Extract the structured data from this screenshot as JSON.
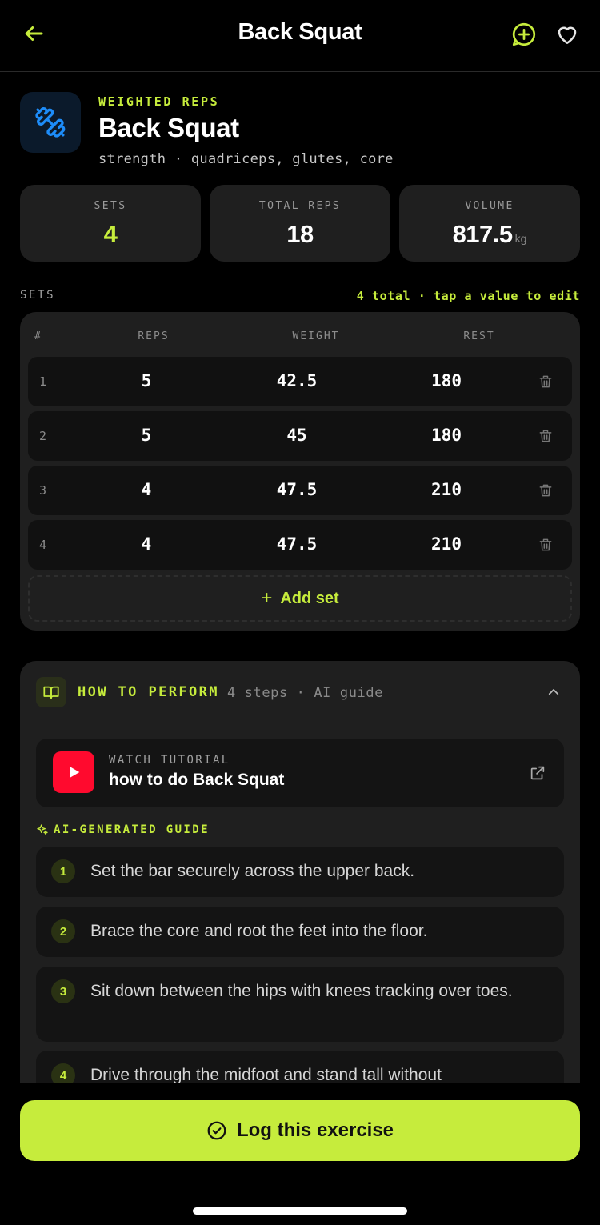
{
  "header": {
    "title": "Back Squat",
    "back_icon": "arrow-left-icon",
    "add_icon": "plus-circle-icon",
    "favorite_icon": "heart-icon"
  },
  "exercise": {
    "type": "WEIGHTED REPS",
    "name": "Back Squat",
    "tags": "strength · quadriceps, glutes, core",
    "icon": "dumbbell-icon"
  },
  "stats": [
    {
      "label": "SETS",
      "value": "4",
      "unit": ""
    },
    {
      "label": "TOTAL REPS",
      "value": "18",
      "unit": ""
    },
    {
      "label": "VOLUME",
      "value": "817.5",
      "unit": "kg"
    }
  ],
  "sets": {
    "heading": "SETS",
    "hint": "4 total · tap a value to edit",
    "columns": {
      "index": "#",
      "reps": "REPS",
      "weight": "WEIGHT",
      "rest": "REST"
    },
    "rows": [
      {
        "index": "1",
        "reps": "5",
        "weight": "42.5",
        "rest": "180"
      },
      {
        "index": "2",
        "reps": "5",
        "weight": "45",
        "rest": "180"
      },
      {
        "index": "3",
        "reps": "4",
        "weight": "47.5",
        "rest": "210"
      },
      {
        "index": "4",
        "reps": "4",
        "weight": "47.5",
        "rest": "210"
      }
    ],
    "add_label": "Add set",
    "add_symbol": "+"
  },
  "guide": {
    "title": "HOW TO PERFORM",
    "meta": "4 steps · AI guide",
    "tutorial_label": "WATCH TUTORIAL",
    "tutorial_text": "how to do Back Squat",
    "ai_label": "AI-GENERATED GUIDE",
    "steps": [
      {
        "num": "1",
        "text": "Set the bar securely across the upper back."
      },
      {
        "num": "2",
        "text": "Brace the core and root the feet into the floor."
      },
      {
        "num": "3",
        "text": "Sit down between the hips with knees tracking over toes."
      },
      {
        "num": "4",
        "text": "Drive through the midfoot and stand tall without"
      }
    ]
  },
  "footer": {
    "log_label": "Log this exercise"
  },
  "colors": {
    "accent": "#c6ec3c",
    "card": "#1f1f1f",
    "background": "#000000",
    "youtube": "#ff0a2e",
    "icon_blue": "#1d8cf8"
  }
}
